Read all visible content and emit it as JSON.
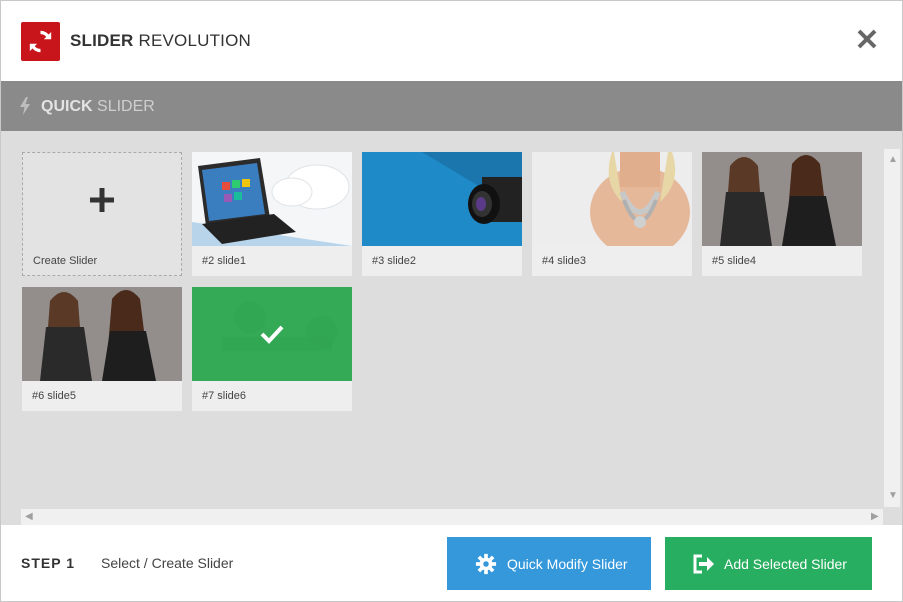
{
  "header": {
    "brand_bold": "SLIDER",
    "brand_light": "REVOLUTION",
    "brand_color": "#c8141b"
  },
  "subheader": {
    "bold": "QUICK",
    "light": "SLIDER",
    "icon": "bolt-icon"
  },
  "grid": {
    "create_label": "Create Slider",
    "items": [
      {
        "label": "#2 slide1",
        "selected": false
      },
      {
        "label": "#3 slide2",
        "selected": false
      },
      {
        "label": "#4 slide3",
        "selected": false
      },
      {
        "label": "#5 slide4",
        "selected": false
      },
      {
        "label": "#6 slide5",
        "selected": false
      },
      {
        "label": "#7 slide6",
        "selected": true
      }
    ],
    "selected_color": "#2ea84f"
  },
  "footer": {
    "step": "STEP 1",
    "step_text": "Select / Create Slider",
    "modify_button": "Quick Modify Slider",
    "add_button": "Add Selected Slider",
    "modify_color": "#3498db",
    "add_color": "#27ae60"
  }
}
